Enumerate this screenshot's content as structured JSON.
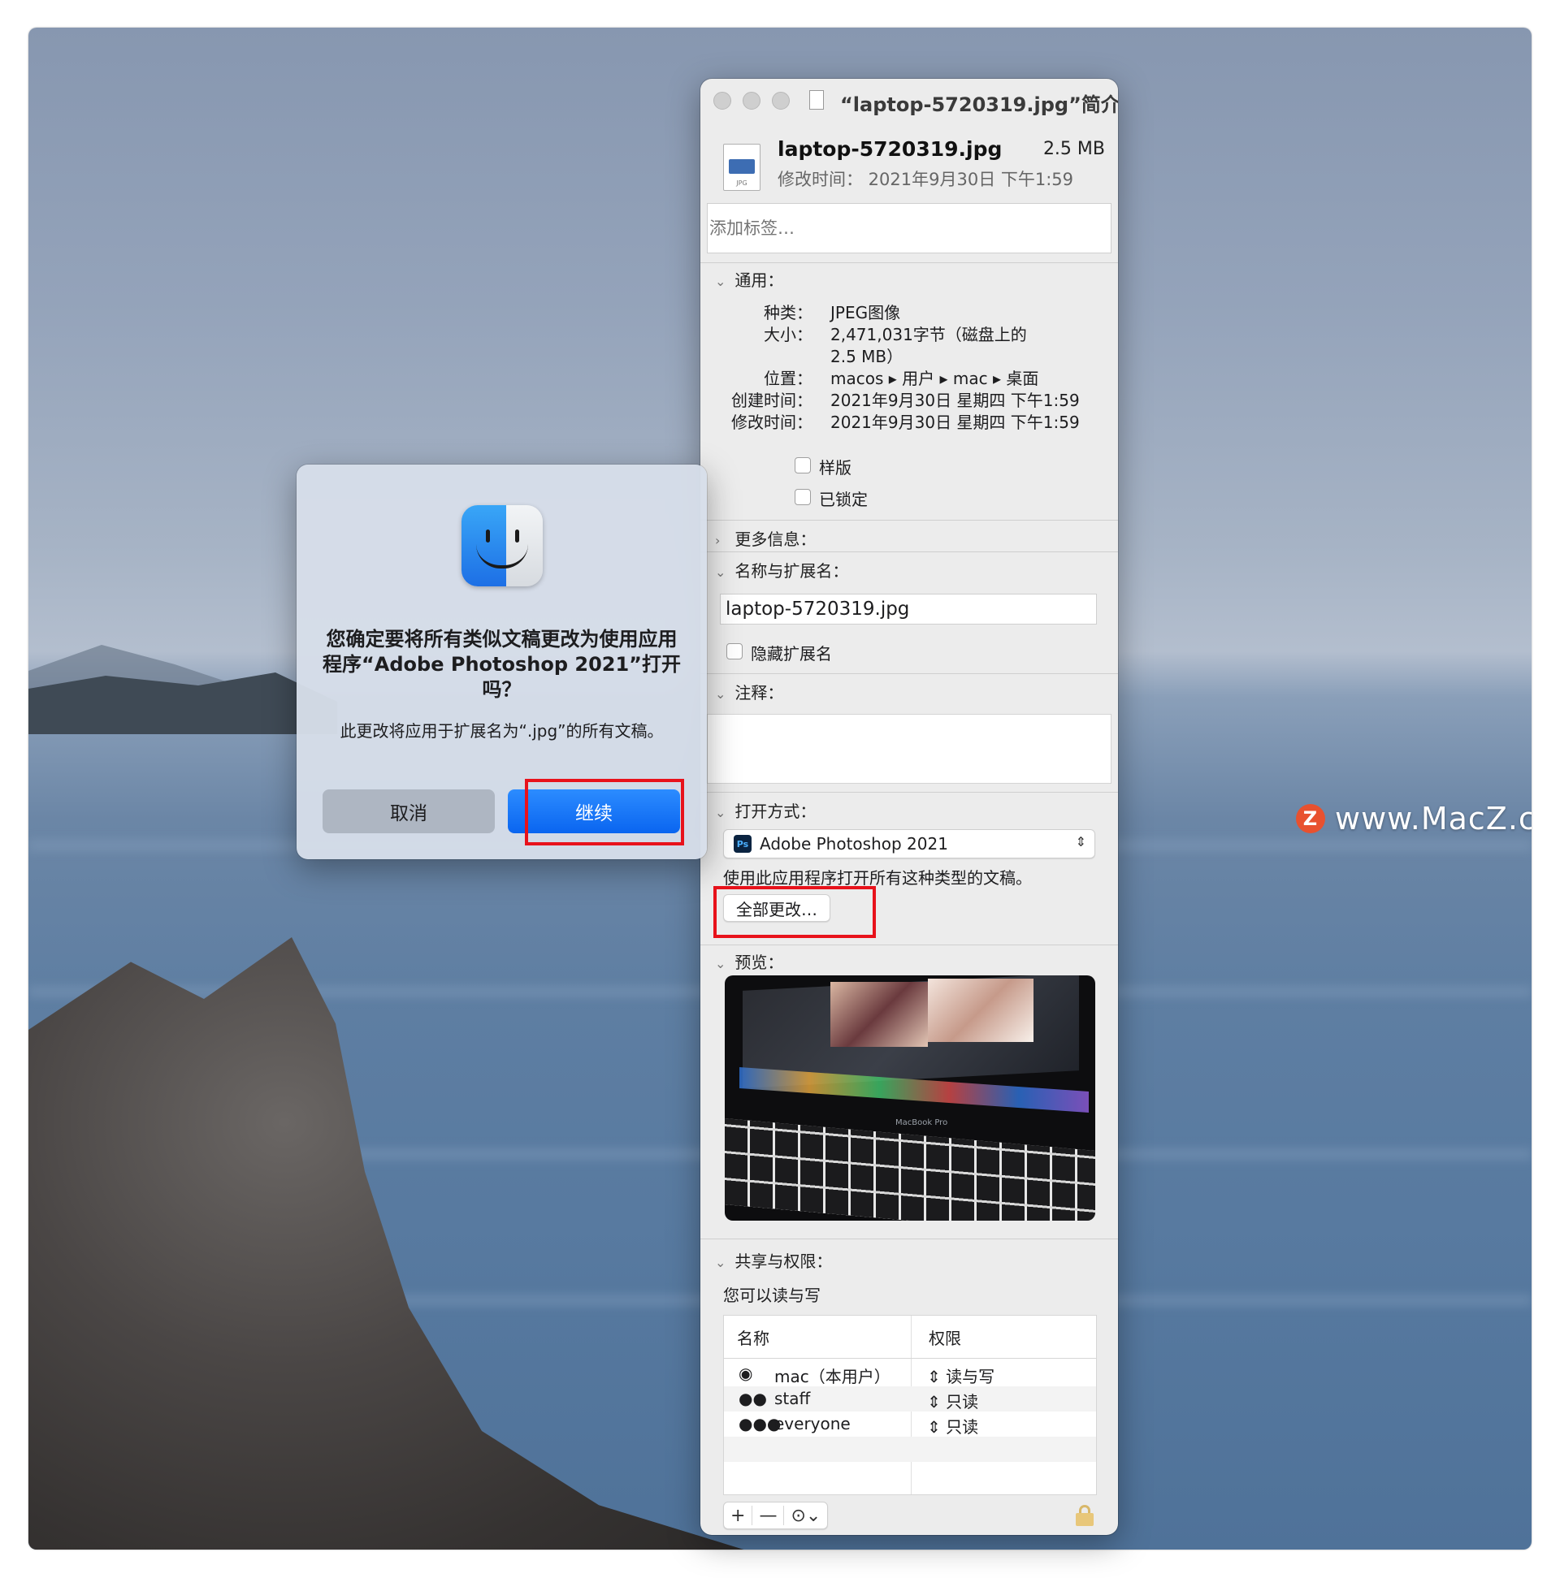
{
  "watermark": {
    "text": "www.MacZ.com",
    "logo_letter": "Z"
  },
  "info_window": {
    "title": "“laptop-5720319.jpg”简介",
    "file_name": "laptop-5720319.jpg",
    "file_size": "2.5 MB",
    "modified_line": "修改时间：  2021年9月30日 下午1:59",
    "file_icon_label": "JPG",
    "tags_placeholder": "添加标签…",
    "general": {
      "header": "通用：",
      "rows": [
        {
          "key": "种类：",
          "value": "JPEG图像"
        },
        {
          "key": "大小：",
          "value": "2,471,031字节（磁盘上的"
        },
        {
          "key": "",
          "value": "2.5 MB）"
        },
        {
          "key": "位置：",
          "value": "macos ▸ 用户 ▸ mac ▸ 桌面"
        },
        {
          "key": "创建时间：",
          "value": "2021年9月30日 星期四 下午1:59"
        },
        {
          "key": "修改时间：",
          "value": "2021年9月30日 星期四 下午1:59"
        }
      ],
      "stationery_label": "样版",
      "locked_label": "已锁定"
    },
    "more_info_header": "更多信息：",
    "name_ext": {
      "header": "名称与扩展名：",
      "value": "laptop-5720319.jpg",
      "hide_ext_label": "隐藏扩展名"
    },
    "comments_header": "注释：",
    "open_with": {
      "header": "打开方式：",
      "app_icon_text": "Ps",
      "app": "Adobe Photoshop 2021",
      "note": "使用此应用程序打开所有这种类型的文稿。",
      "change_all_label": "全部更改…"
    },
    "preview_header": "预览：",
    "preview_device_label": "MacBook Pro",
    "sharing": {
      "header": "共享与权限：",
      "note": "您可以读与写",
      "col_name": "名称",
      "col_priv": "权限",
      "rows": [
        {
          "icon": "user-icon",
          "name": "mac（本用户）",
          "priv": "读与写"
        },
        {
          "icon": "group-icon",
          "name": "staff",
          "priv": "只读"
        },
        {
          "icon": "everyone-icon",
          "name": "everyone",
          "priv": "只读"
        }
      ],
      "add_label": "+",
      "remove_label": "—",
      "action_label": "⊙⌄"
    }
  },
  "dialog": {
    "title": "您确定要将所有类似文稿更改为使用应用程序“Adobe Photoshop 2021”打开吗？",
    "message": "此更改将应用于扩展名为“.jpg”的所有文稿。",
    "cancel_label": "取消",
    "continue_label": "继续"
  },
  "colors": {
    "highlight_box": "#e8121b",
    "primary_button": "#0a65f0"
  }
}
